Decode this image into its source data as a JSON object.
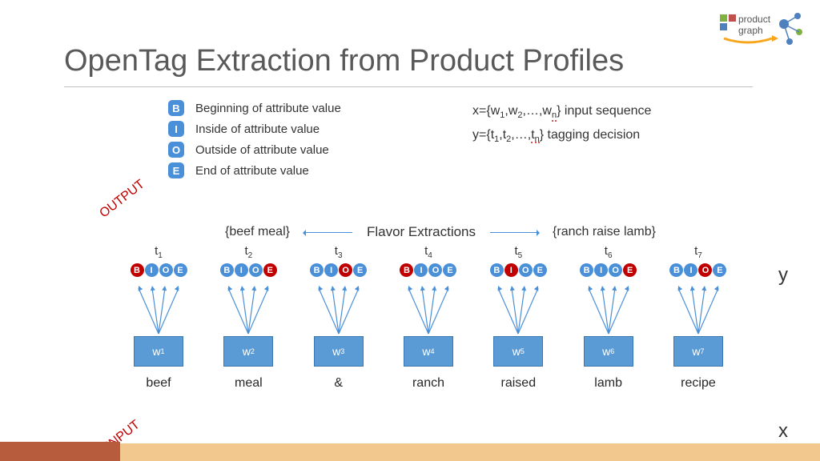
{
  "title": "OpenTag Extraction from Product Profiles",
  "logo": {
    "text1": "product",
    "text2": "graph"
  },
  "legend": [
    {
      "tag": "B",
      "desc": "Beginning of attribute value"
    },
    {
      "tag": "I",
      "desc": "Inside of attribute value"
    },
    {
      "tag": "O",
      "desc": "Outside of attribute value"
    },
    {
      "tag": "E",
      "desc": "End of attribute value"
    }
  ],
  "notation": {
    "x_prefix": "x={w",
    "y_prefix": "y={t",
    "seq_mid": ",…,",
    "x_end": "} input sequence",
    "y_end": "} tagging decision",
    "sub1": "1",
    "sub2": "2",
    "subn": "n",
    "x_last_sym": "w",
    "y_last_sym": "t"
  },
  "flavor": {
    "title": "Flavor Extractions",
    "left": "{beef meal}",
    "right": "{ranch raise lamb}"
  },
  "labels": {
    "output": "OUTPUT",
    "input": "INPUT",
    "y": "y",
    "x": "x"
  },
  "columns": [
    {
      "t": "1",
      "w": "1",
      "word": "beef",
      "active": "B"
    },
    {
      "t": "2",
      "w": "2",
      "word": "meal",
      "active": "E"
    },
    {
      "t": "3",
      "w": "3",
      "word": "&",
      "active": "O"
    },
    {
      "t": "4",
      "w": "4",
      "word": "ranch",
      "active": "B"
    },
    {
      "t": "5",
      "w": "5",
      "word": "raised",
      "active": "I"
    },
    {
      "t": "6",
      "w": "6",
      "word": "lamb",
      "active": "E"
    },
    {
      "t": "7",
      "w": "7",
      "word": "recipe",
      "active": "O"
    }
  ],
  "bioe_letters": [
    "B",
    "I",
    "O",
    "E"
  ],
  "t_sym": "t",
  "w_sym": "w",
  "comma": ","
}
